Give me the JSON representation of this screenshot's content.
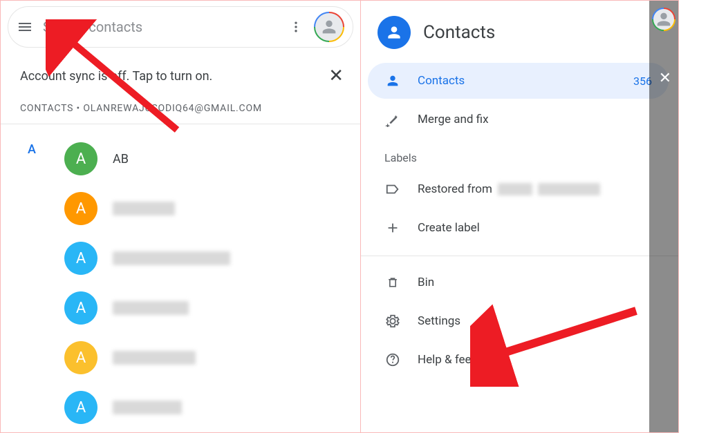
{
  "left": {
    "search_placeholder": "Search contacts",
    "sync_message": "Account sync is off. Tap to turn on.",
    "account_line": "CONTACTS • OLANREWAJUSODIQ64@GMAIL.COM",
    "section_letter": "A",
    "contacts": [
      {
        "initial": "A",
        "name": "AB",
        "color": "c-green",
        "blurred": false
      },
      {
        "initial": "A",
        "name": "",
        "color": "c-orange",
        "blurred": true
      },
      {
        "initial": "A",
        "name": "",
        "color": "c-blue",
        "blurred": true
      },
      {
        "initial": "A",
        "name": "",
        "color": "c-blue",
        "blurred": true
      },
      {
        "initial": "A",
        "name": "",
        "color": "c-yellow",
        "blurred": true
      },
      {
        "initial": "A",
        "name": "",
        "color": "c-blue",
        "blurred": true
      }
    ]
  },
  "right": {
    "title": "Contacts",
    "nav": {
      "contacts": {
        "label": "Contacts",
        "count": "356"
      },
      "merge": {
        "label": "Merge and fix"
      }
    },
    "labels_header": "Labels",
    "labels": {
      "restored": {
        "prefix": "Restored from"
      },
      "create": {
        "label": "Create label"
      }
    },
    "footer": {
      "bin": "Bin",
      "settings": "Settings",
      "help": "Help & feedback"
    }
  }
}
